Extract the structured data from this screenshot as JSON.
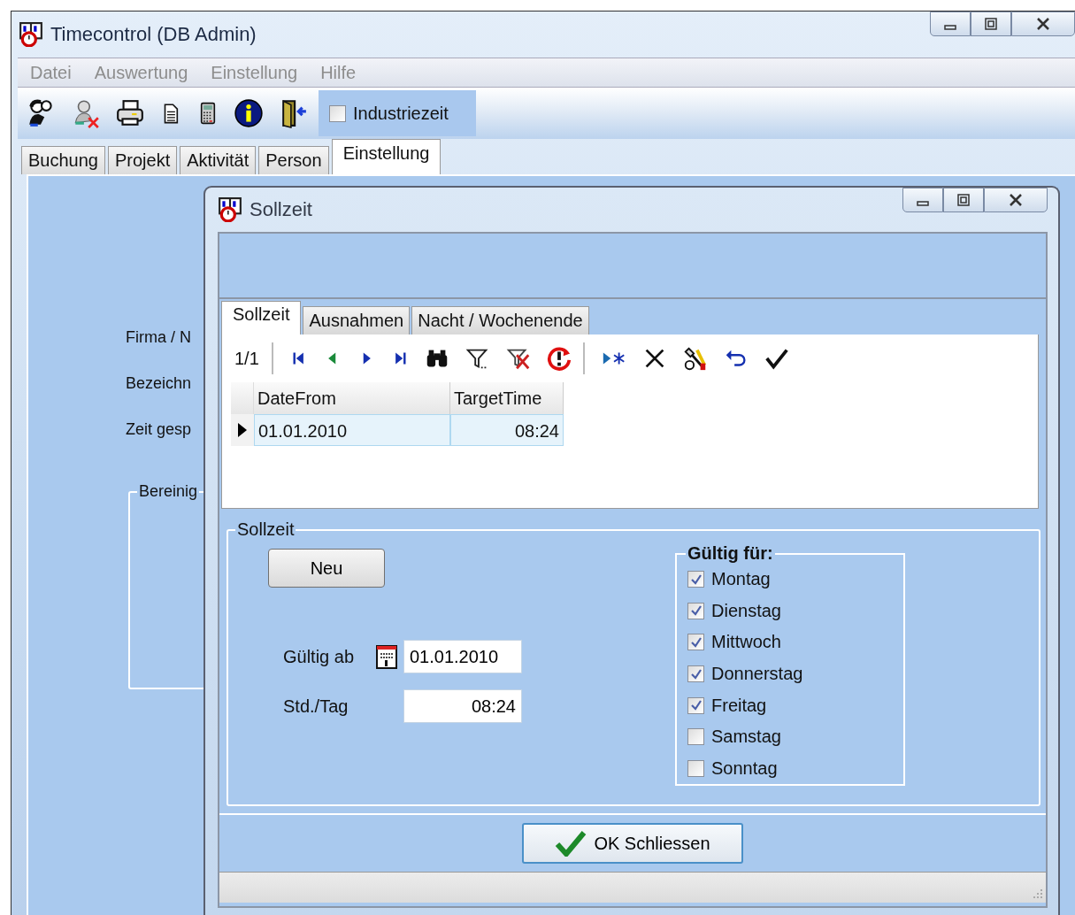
{
  "window": {
    "title": "Timecontrol (DB Admin)"
  },
  "menu": [
    "Datei",
    "Auswertung",
    "Einstellung",
    "Hilfe"
  ],
  "toolbar": {
    "option": {
      "label": "Industriezeit",
      "checked": false
    }
  },
  "tabs": [
    {
      "label": "Buchung",
      "selected": false
    },
    {
      "label": "Projekt",
      "selected": false
    },
    {
      "label": "Aktivität",
      "selected": false
    },
    {
      "label": "Person",
      "selected": false
    },
    {
      "label": "Einstellung",
      "selected": true
    }
  ],
  "form_labels": [
    "Firma / N",
    "Bezeichn",
    "Zeit gesp"
  ],
  "group_title": "Bereinig",
  "dialog": {
    "title": "Sollzeit",
    "tabs": [
      {
        "label": "Sollzeit",
        "selected": true
      },
      {
        "label": "Ausnahmen",
        "selected": false
      },
      {
        "label": "Nacht / Wochenende",
        "selected": false
      }
    ],
    "navigator": {
      "position": "1/1"
    },
    "table": {
      "columns": [
        "DateFrom",
        "TargetTime"
      ],
      "rows": [
        {
          "cells": [
            "01.01.2010",
            "08:24"
          ],
          "selected": true
        }
      ]
    },
    "group": {
      "title": "Sollzeit",
      "new_button": "Neu",
      "fields": [
        {
          "kind": "date",
          "label": "Gültig ab",
          "value": "01.01.2010"
        },
        {
          "kind": "time",
          "label": "Std./Tag",
          "value": "08:24"
        }
      ],
      "days": {
        "title": "Gültig für:",
        "items": [
          {
            "label": "Montag",
            "checked": true
          },
          {
            "label": "Dienstag",
            "checked": true
          },
          {
            "label": "Mittwoch",
            "checked": true
          },
          {
            "label": "Donnerstag",
            "checked": true
          },
          {
            "label": "Freitag",
            "checked": true
          },
          {
            "label": "Samstag",
            "checked": false
          },
          {
            "label": "Sonntag",
            "checked": false
          }
        ]
      }
    },
    "ok_button": "OK Schliessen"
  }
}
